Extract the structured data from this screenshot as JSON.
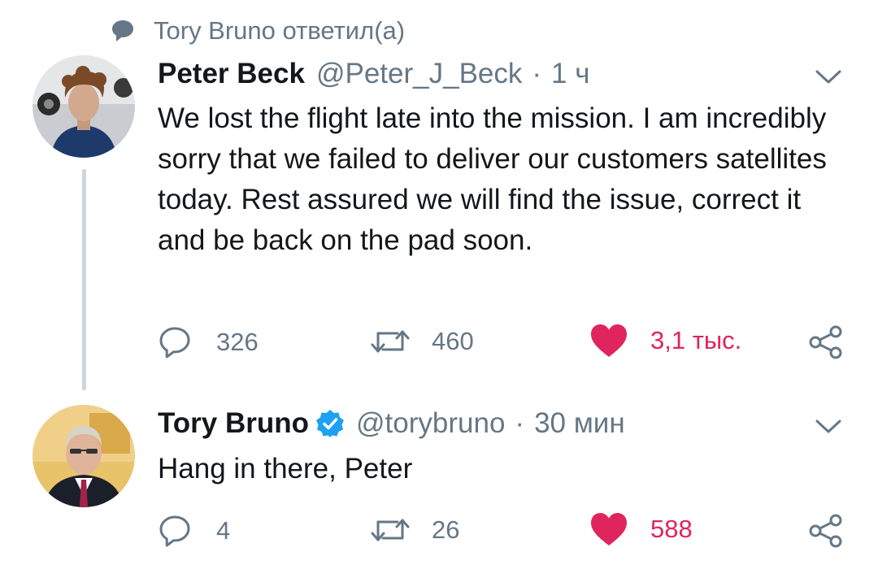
{
  "context": {
    "text": "Tory Bruno ответил(а)",
    "icon": "speech-bubble-icon"
  },
  "tweets": [
    {
      "name": "Peter Beck",
      "handle": "@Peter_J_Beck",
      "separator": "·",
      "time": "1 ч",
      "verified": false,
      "text": "We lost the flight late into the mission. I am incredibly sorry that we failed to deliver our customers satellites today. Rest assured we will find the issue, correct it and be back on the pad soon.",
      "replies": "326",
      "retweets": "460",
      "likes": "3,1 тыс.",
      "liked": true
    },
    {
      "name": "Tory Bruno",
      "handle": "@torybruno",
      "separator": "·",
      "time": "30 мин",
      "verified": true,
      "text": "Hang in there, Peter",
      "replies": "4",
      "retweets": "26",
      "likes": "588",
      "liked": true
    }
  ],
  "colors": {
    "like": "#e0245e",
    "gray": "#657786",
    "verified": "#1da1f2",
    "thread": "#ccd6dd"
  }
}
